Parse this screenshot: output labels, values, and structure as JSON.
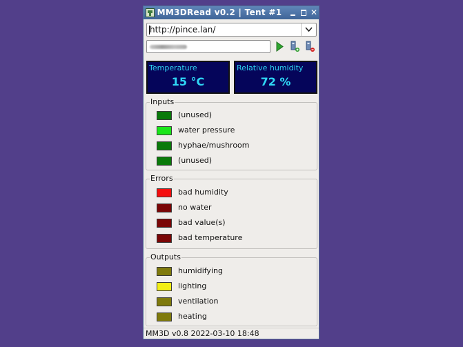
{
  "window": {
    "title": "MM3DRead v0.2 | Tent #1",
    "close_glyph": "✕"
  },
  "connection": {
    "url": "http://pince.lan/"
  },
  "sensors": [
    {
      "label": "Temperature",
      "value": "15 °C"
    },
    {
      "label": "Relative humidity",
      "value": "72 %"
    }
  ],
  "groups": {
    "inputs": {
      "title": "Inputs",
      "items": [
        {
          "label": "(unused)",
          "color": "#0a7a0a"
        },
        {
          "label": "water pressure",
          "color": "#19e619"
        },
        {
          "label": "hyphae/mushroom",
          "color": "#0a7a0a"
        },
        {
          "label": "(unused)",
          "color": "#0a7a0a"
        }
      ]
    },
    "errors": {
      "title": "Errors",
      "items": [
        {
          "label": "bad humidity",
          "color": "#f40e0e"
        },
        {
          "label": "no water",
          "color": "#7a0606"
        },
        {
          "label": "bad value(s)",
          "color": "#7a0606"
        },
        {
          "label": "bad temperature",
          "color": "#7a0606"
        }
      ]
    },
    "outputs": {
      "title": "Outputs",
      "items": [
        {
          "label": "humidifying",
          "color": "#7f7a0c"
        },
        {
          "label": "lighting",
          "color": "#f2ee14"
        },
        {
          "label": "ventilation",
          "color": "#7f7a0c"
        },
        {
          "label": "heating",
          "color": "#7f7a0c"
        }
      ]
    }
  },
  "statusbar": {
    "text": "MM3D v0.8  2022-03-10 18:48"
  },
  "icons": {
    "play": "play-icon",
    "add": "add-device-icon",
    "remove": "remove-device-icon",
    "app": "app-icon"
  }
}
